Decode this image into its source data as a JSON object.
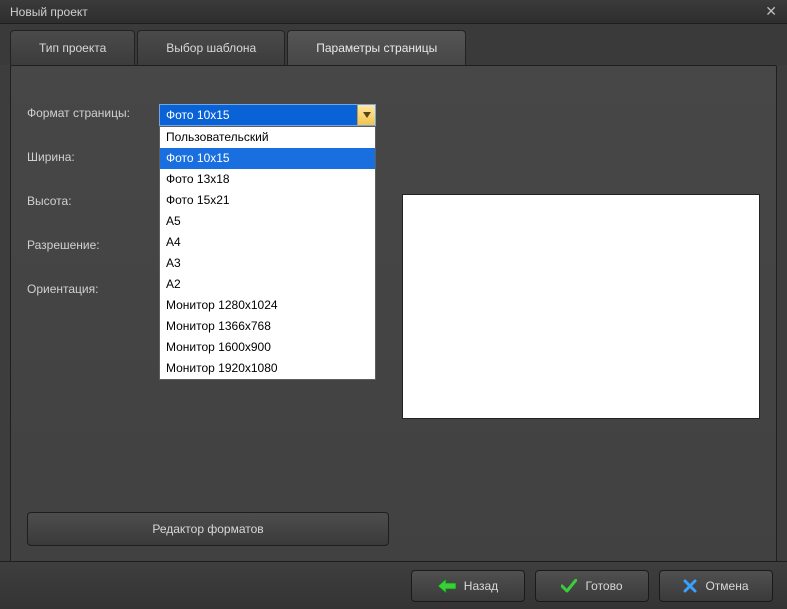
{
  "window": {
    "title": "Новый проект"
  },
  "tabs": [
    {
      "label": "Тип проекта"
    },
    {
      "label": "Выбор шаблона"
    },
    {
      "label": "Параметры страницы"
    }
  ],
  "form": {
    "format_label": "Формат страницы:",
    "width_label": "Ширина:",
    "height_label": "Высота:",
    "resolution_label": "Разрешение:",
    "orientation_label": "Ориентация:",
    "selected": "Фото 10x15",
    "options": [
      "Пользовательский",
      "Фото 10x15",
      "Фото 13x18",
      "Фото 15x21",
      "A5",
      "A4",
      "A3",
      "A2",
      "Монитор 1280x1024",
      "Монитор 1366x768",
      "Монитор 1600x900",
      "Монитор 1920x1080"
    ],
    "editor_button": "Редактор форматов"
  },
  "footer": {
    "back": "Назад",
    "done": "Готово",
    "cancel": "Отмена"
  }
}
